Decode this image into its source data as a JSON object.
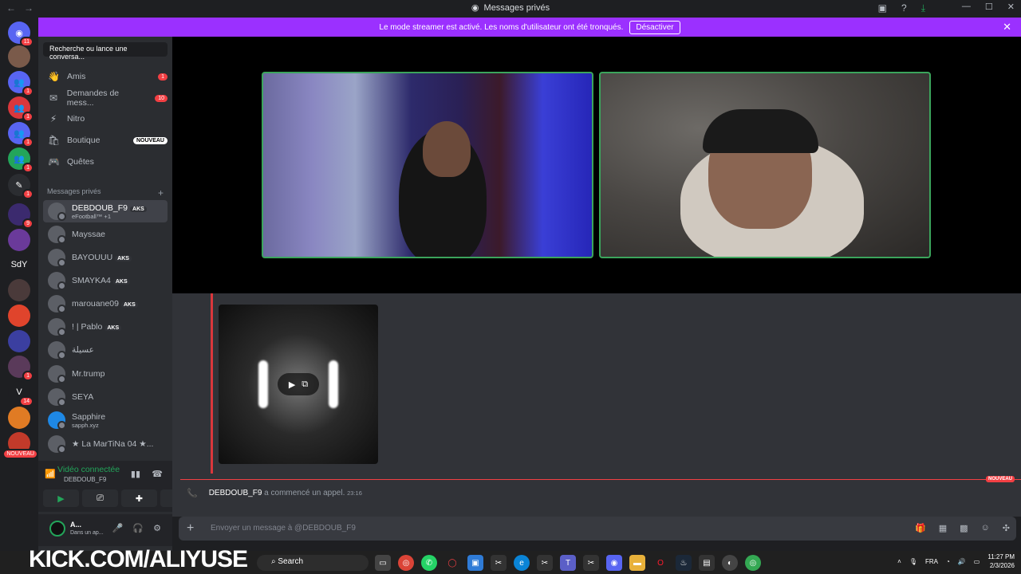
{
  "window": {
    "title": "Messages privés",
    "back": "←",
    "forward": "→",
    "min": "—",
    "max": "☐",
    "close": "✕"
  },
  "banner": {
    "text": "Le mode streamer est activé. Les noms d'utilisateur ont été tronqués.",
    "button": "Désactiver"
  },
  "servers": [
    {
      "badge": "11",
      "color": "#5865f2"
    },
    {
      "badge": "",
      "color": "#7a5a4a"
    },
    {
      "badge": "1",
      "color": "#5865f2"
    },
    {
      "badge": "1",
      "color": "#da373c"
    },
    {
      "badge": "1",
      "color": "#5865f2"
    },
    {
      "badge": "1",
      "color": "#23a55a"
    },
    {
      "badge": "1",
      "color": "#2b2d31"
    },
    {
      "badge": "9",
      "color": "#3b2a6e"
    },
    {
      "badge": "",
      "color": "#6a3a9a"
    },
    {
      "label": "SdY",
      "badge": "",
      "color": "#1e1f22"
    },
    {
      "badge": "",
      "color": "#4a3a3a"
    },
    {
      "badge": "",
      "color": "#e0442c"
    },
    {
      "badge": "",
      "color": "#3b3fa0"
    },
    {
      "badge": "1",
      "color": "#5a3a5a"
    },
    {
      "badge": "14",
      "color": "#1e1f22"
    },
    {
      "badge": "",
      "color": "#e07b24"
    },
    {
      "badge": "NOUVEAU",
      "color": "#c23a2a"
    }
  ],
  "sidebar": {
    "search_placeholder": "Recherche ou lance une conversa...",
    "nav": [
      {
        "label": "Amis",
        "badge": "1"
      },
      {
        "label": "Demandes de mess...",
        "badge": "10"
      },
      {
        "label": "Nitro",
        "badge": ""
      },
      {
        "label": "Boutique",
        "badge": "NOUVEAU"
      },
      {
        "label": "Quêtes",
        "badge": ""
      }
    ],
    "section_label": "Messages privés",
    "section_add": "+",
    "dms": [
      {
        "name": "DEBDOUB_F9",
        "tag": "AKS",
        "sub": "eFootball™ +1",
        "active": true
      },
      {
        "name": "Mayssae",
        "tag": "",
        "sub": ""
      },
      {
        "name": "BAYOUUU",
        "tag": "AKS",
        "sub": ""
      },
      {
        "name": "SMAYKA4",
        "tag": "AKS",
        "sub": ""
      },
      {
        "name": "marouane09",
        "tag": "AKS",
        "sub": ""
      },
      {
        "name": "! | Pablo",
        "tag": "AKS",
        "sub": ""
      },
      {
        "name": "عسيلة",
        "tag": "",
        "sub": ""
      },
      {
        "name": "Mr.trump",
        "tag": "",
        "sub": ""
      },
      {
        "name": "SEYA",
        "tag": "",
        "sub": ""
      },
      {
        "name": "Sapphire",
        "tag": "",
        "sub": "sapph.xyz"
      },
      {
        "name": "★ La MarTiNa 04 ★...",
        "tag": "",
        "sub": ""
      }
    ]
  },
  "voice": {
    "status": "Vidéo connectée",
    "channel": "DEBDOUB_F9"
  },
  "user": {
    "name": "A...",
    "status": "Dans un ap..."
  },
  "chat": {
    "new_label": "NOUVEAU",
    "call_user": "DEBDOUB_F9",
    "call_text": "a commencé un appel.",
    "call_time": "23:16",
    "input_placeholder": "Envoyer un message à @DEBDOUB_F9"
  },
  "taskbar": {
    "overlay": "KICK.COM/ALIYUSE",
    "search": "Search",
    "lang": "FRA",
    "time": "11:27 PM",
    "date": "2/3/2026"
  }
}
